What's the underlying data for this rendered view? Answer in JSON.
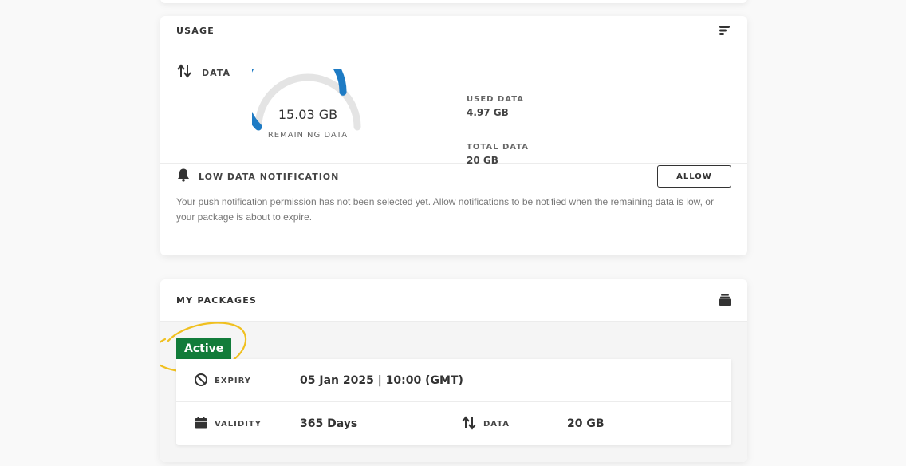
{
  "usage": {
    "title": "USAGE",
    "header_icon": "sort-lines-icon",
    "data_label": "DATA",
    "gauge": {
      "remaining_value": "15.03 GB",
      "remaining_label": "REMAINING DATA",
      "used_fraction": 0.2485,
      "fill_color": "#1e7bc4",
      "track_color": "#e4e4e4"
    },
    "used": {
      "label": "USED DATA",
      "value": "4.97 GB"
    },
    "total": {
      "label": "TOTAL DATA",
      "value": "20 GB"
    },
    "notification": {
      "title": "LOW DATA NOTIFICATION",
      "button": "ALLOW",
      "text": "Your push notification permission has not been selected yet. Allow notifications to be notified when the remaining data is low, or your package is about to expire."
    }
  },
  "packages": {
    "title": "MY PACKAGES",
    "header_icon": "stack-icon",
    "status_badge": "Active",
    "badge_color": "#127c3a",
    "annotation_color": "#f0c020",
    "expiry": {
      "label": "EXPIRY",
      "value": "05 Jan 2025 | 10:00 (GMT)"
    },
    "validity": {
      "label": "VALIDITY",
      "value": "365 Days"
    },
    "data": {
      "label": "DATA",
      "value": "20 GB"
    }
  }
}
